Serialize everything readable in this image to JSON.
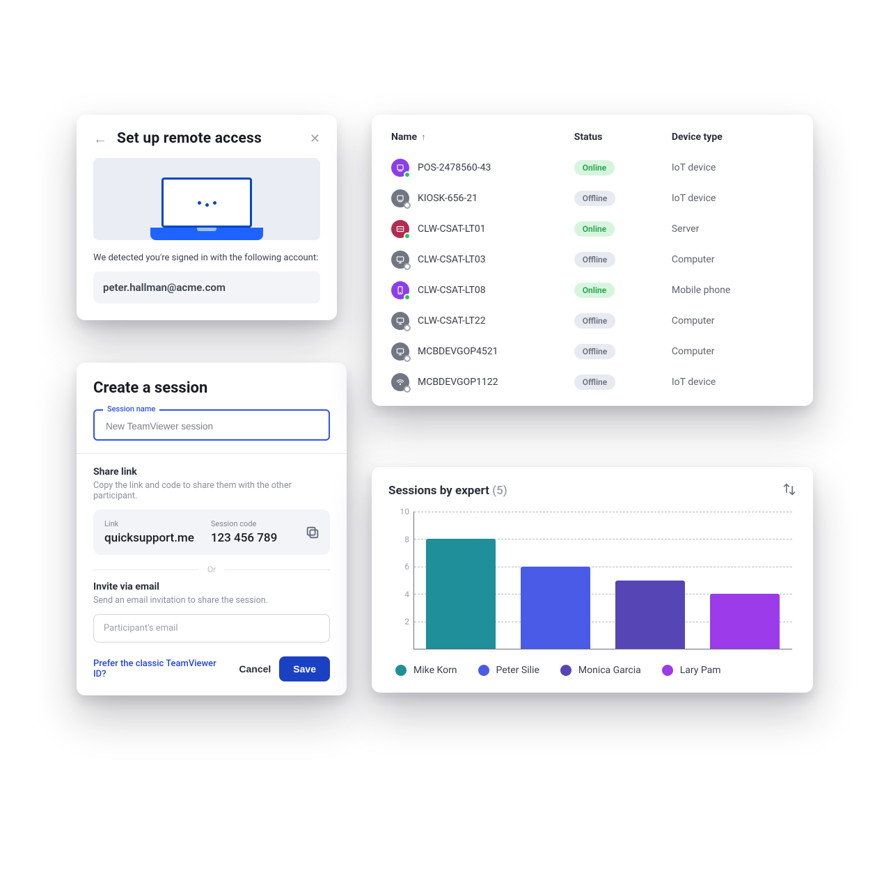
{
  "remote": {
    "title": "Set up remote access",
    "detected_msg": "We detected you're signed in with the following account:",
    "email": "peter.hallman@acme.com"
  },
  "session": {
    "title": "Create a session",
    "name_label": "Session name",
    "name_value": "New TeamViewer session",
    "share_heading": "Share link",
    "share_sub": "Copy the link and code to share them with the other participant.",
    "link_label": "Link",
    "link_value": "quicksupport.me",
    "code_label": "Session code",
    "code_value": "123 456 789",
    "or": "Or",
    "invite_heading": "Invite via email",
    "invite_sub": "Send an email invitation to share the session.",
    "email_placeholder": "Participant's email",
    "classic_link": "Prefer the classic TeamViewer ID?",
    "cancel": "Cancel",
    "save": "Save"
  },
  "devices": {
    "col_name": "Name",
    "col_status": "Status",
    "col_type": "Device type",
    "status_online": "Online",
    "status_offline": "Offline",
    "rows": [
      {
        "name": "POS-2478560-43",
        "status": "Online",
        "type": "IoT device",
        "color": "#8c3fe8",
        "icon": "iot"
      },
      {
        "name": "KIOSK-656-21",
        "status": "Offline",
        "type": "IoT device",
        "color": "#707682",
        "icon": "iot"
      },
      {
        "name": "CLW-CSAT-LT01",
        "status": "Online",
        "type": "Server",
        "color": "#b32b4f",
        "icon": "server"
      },
      {
        "name": "CLW-CSAT-LT03",
        "status": "Offline",
        "type": "Computer",
        "color": "#707682",
        "icon": "computer"
      },
      {
        "name": "CLW-CSAT-LT08",
        "status": "Online",
        "type": "Mobile phone",
        "color": "#8c3fe8",
        "icon": "mobile"
      },
      {
        "name": "CLW-CSAT-LT22",
        "status": "Offline",
        "type": "Computer",
        "color": "#707682",
        "icon": "computer"
      },
      {
        "name": "MCBDEVGOP4521",
        "status": "Offline",
        "type": "Computer",
        "color": "#707682",
        "icon": "computer"
      },
      {
        "name": "MCBDEVGOP1122",
        "status": "Offline",
        "type": "IoT device",
        "color": "#707682",
        "icon": "iot2"
      }
    ]
  },
  "chart_data": {
    "type": "bar",
    "title": "Sessions by expert",
    "count_suffix": "(5)",
    "ylim": [
      0,
      10
    ],
    "yticks": [
      2,
      4,
      6,
      8,
      10
    ],
    "categories": [
      "Mike Korn",
      "Peter Silie",
      "Monica Garcia",
      "Lary Pam"
    ],
    "values": [
      8,
      6,
      5,
      4
    ],
    "colors": [
      "#1f8f99",
      "#4a5be8",
      "#5646b5",
      "#9b3bea"
    ]
  }
}
